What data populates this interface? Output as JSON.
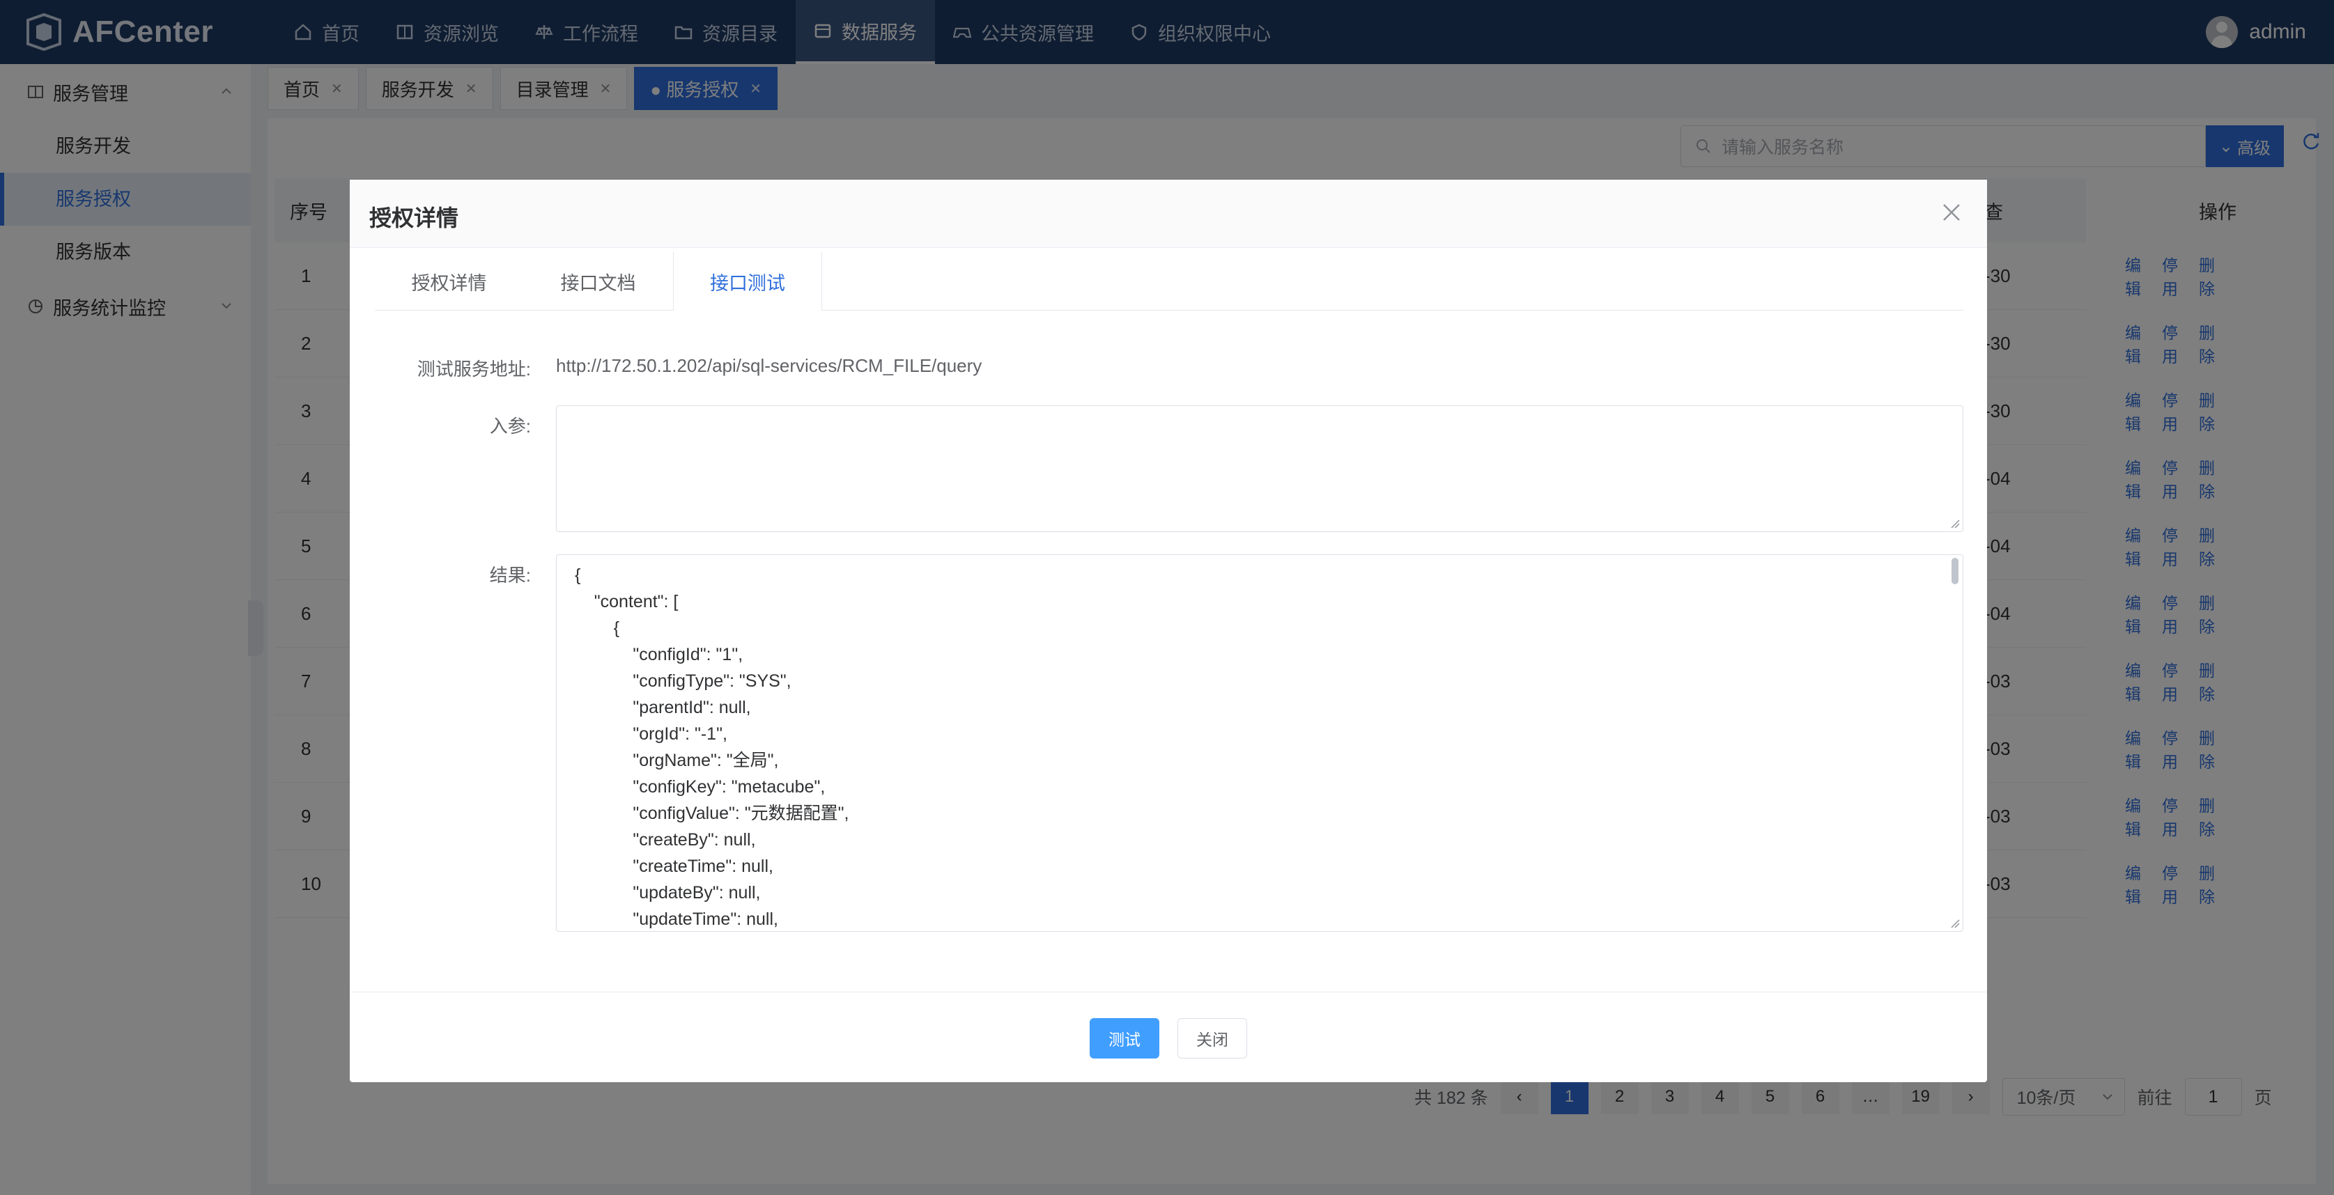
{
  "app": {
    "name": "AFCenter",
    "user": "admin"
  },
  "nav": {
    "items": [
      {
        "label": "首页",
        "icon": "home-icon"
      },
      {
        "label": "资源浏览",
        "icon": "book-icon"
      },
      {
        "label": "工作流程",
        "icon": "scale-icon"
      },
      {
        "label": "资源目录",
        "icon": "folder-icon"
      },
      {
        "label": "数据服务",
        "icon": "box-icon",
        "active": true
      },
      {
        "label": "公共资源管理",
        "icon": "gamepad-icon"
      },
      {
        "label": "组织权限中心",
        "icon": "shield-icon"
      }
    ]
  },
  "sidebar": {
    "group1": "服务管理",
    "items": [
      "服务开发",
      "服务授权",
      "服务版本"
    ],
    "group2": "服务统计监控"
  },
  "tabs": [
    {
      "label": "首页"
    },
    {
      "label": "服务开发"
    },
    {
      "label": "目录管理"
    },
    {
      "label": "● 服务授权",
      "active": true
    }
  ],
  "list": {
    "search_placeholder": "请输入服务名称",
    "advanced_label": "高级",
    "header_no": "序号",
    "header_time_suffix": "查",
    "header_op": "操作",
    "rows": [
      {
        "no": "1",
        "date": "-30"
      },
      {
        "no": "2",
        "date": "-30"
      },
      {
        "no": "3",
        "date": "-30"
      },
      {
        "no": "4",
        "date": "-04"
      },
      {
        "no": "5",
        "date": "-04"
      },
      {
        "no": "6",
        "date": "-04"
      },
      {
        "no": "7",
        "date": "-03"
      },
      {
        "no": "8",
        "date": "-03"
      },
      {
        "no": "9",
        "date": "-03"
      },
      {
        "no": "10",
        "date": "-03"
      }
    ],
    "op_edit": "编辑",
    "op_disable": "停用",
    "op_delete": "删除"
  },
  "pager": {
    "total": "共 182 条",
    "pages": [
      "1",
      "2",
      "3",
      "4",
      "5",
      "6",
      "…",
      "19"
    ],
    "page_size": "10条/页",
    "goto_prefix": "前往",
    "goto_value": "1",
    "goto_suffix": "页"
  },
  "modal": {
    "title": "授权详情",
    "tabs": [
      "授权详情",
      "接口文档",
      "接口测试"
    ],
    "active_tab": "接口测试",
    "url_label": "测试服务地址:",
    "url_value": "http://172.50.1.202/api/sql-services/RCM_FILE/query",
    "input_label": "入参:",
    "result_label": "结果:",
    "result_text": "{\n    \"content\": [\n        {\n            \"configId\": \"1\",\n            \"configType\": \"SYS\",\n            \"parentId\": null,\n            \"orgId\": \"-1\",\n            \"orgName\": \"全局\",\n            \"configKey\": \"metacube\",\n            \"configValue\": \"元数据配置\",\n            \"createBy\": null,\n            \"createTime\": null,\n            \"updateBy\": null,\n            \"updateTime\": null,",
    "test_button": "测试",
    "close_button": "关闭"
  }
}
